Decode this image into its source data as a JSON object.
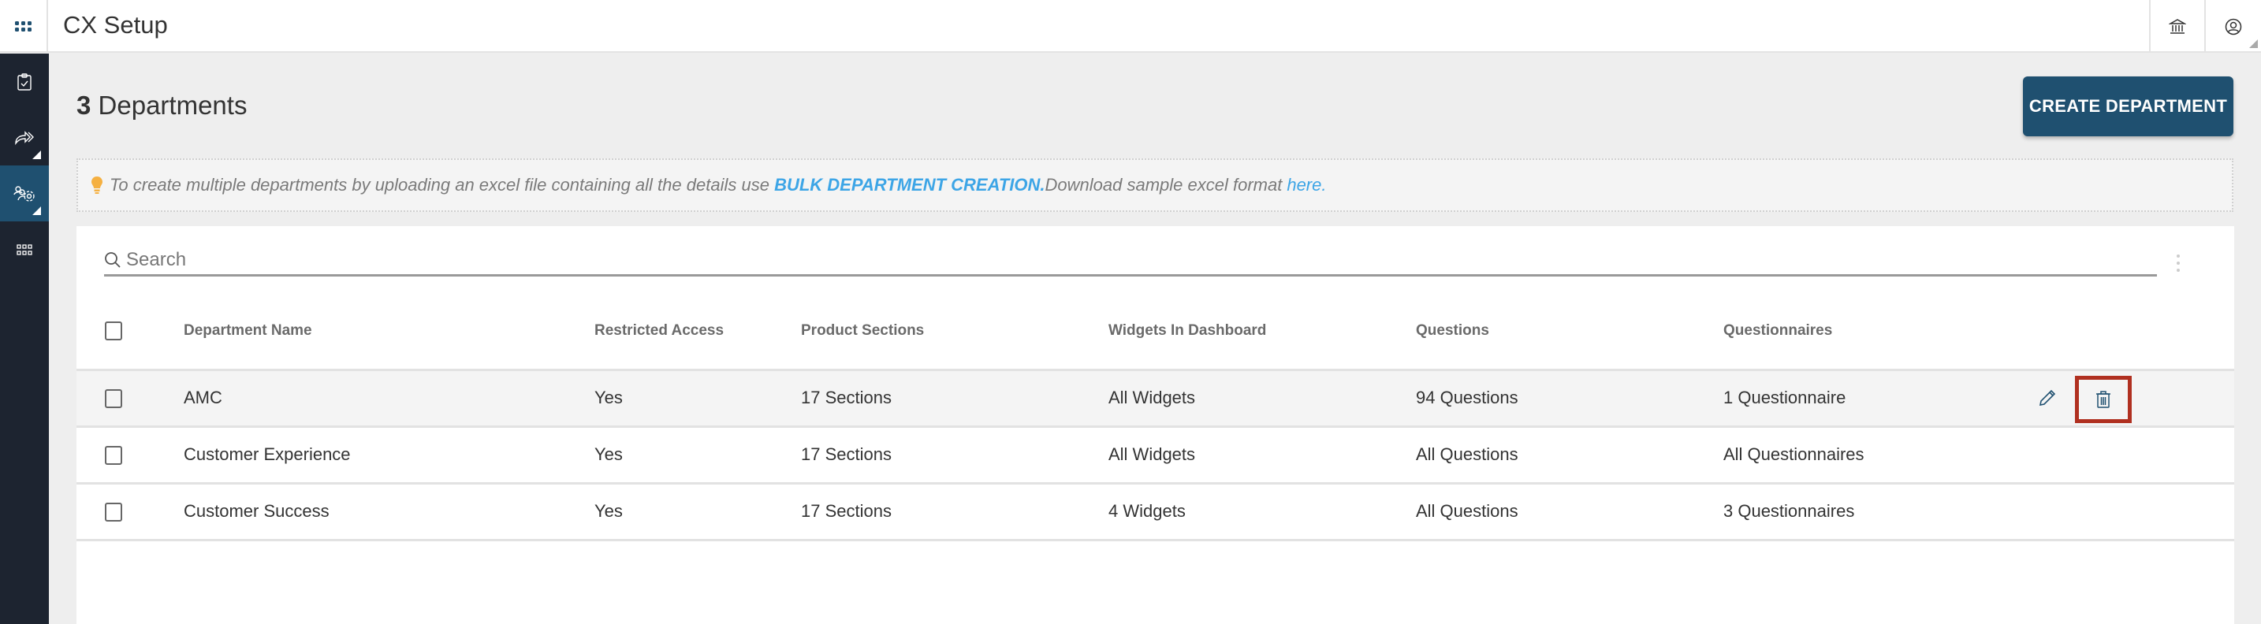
{
  "header": {
    "app_title": "CX Setup",
    "apps_icon": "apps-grid-icon",
    "right_icons": [
      "bank-icon",
      "user-account-icon"
    ]
  },
  "sidebar": {
    "items": [
      {
        "icon": "clipboard-check-icon",
        "active": false,
        "has_submenu": false
      },
      {
        "icon": "share-forward-icon",
        "active": false,
        "has_submenu": true
      },
      {
        "icon": "team-settings-icon",
        "active": true,
        "has_submenu": true
      },
      {
        "icon": "grid-icon",
        "active": false,
        "has_submenu": false
      }
    ]
  },
  "page": {
    "count": "3",
    "title": "Departments",
    "create_button": "CREATE DEPARTMENT"
  },
  "info": {
    "text": "To create multiple departments by uploading an excel file containing all the details use",
    "bulk_link": "BULK DEPARTMENT CREATION.",
    "download_text": "Download sample excel format",
    "here_link": "here."
  },
  "search": {
    "placeholder": "Search",
    "value": ""
  },
  "table": {
    "columns": [
      "Department Name",
      "Restricted Access",
      "Product Sections",
      "Widgets In Dashboard",
      "Questions",
      "Questionnaires"
    ],
    "rows": [
      {
        "name": "AMC",
        "restricted": "Yes",
        "sections": "17 Sections",
        "widgets": "All Widgets",
        "questions": "94 Questions",
        "questionnaires": "1 Questionnaire",
        "hovered": true
      },
      {
        "name": "Customer Experience",
        "restricted": "Yes",
        "sections": "17 Sections",
        "widgets": "All Widgets",
        "questions": "All Questions",
        "questionnaires": "All Questionnaires",
        "hovered": false
      },
      {
        "name": "Customer Success",
        "restricted": "Yes",
        "sections": "17 Sections",
        "widgets": "4 Widgets",
        "questions": "All Questions",
        "questionnaires": "3 Questionnaires",
        "hovered": false
      }
    ]
  },
  "colors": {
    "primary": "#1f5070",
    "sidebar_bg": "#1d2430",
    "link": "#3da5e6",
    "bulb": "#f5b041",
    "highlight_box": "#b03020"
  }
}
